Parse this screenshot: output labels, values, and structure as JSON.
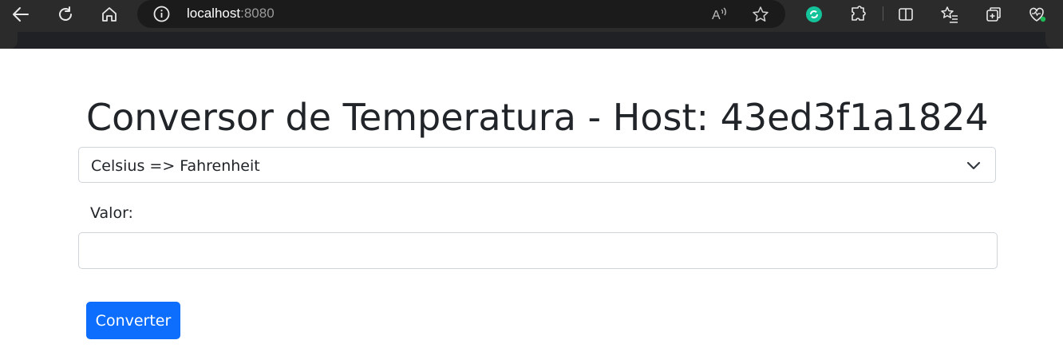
{
  "browser": {
    "url_host": "localhost",
    "url_port": ":8080",
    "icons": [
      "back-icon",
      "reload-icon",
      "home-icon",
      "site-info-icon",
      "read-aloud-icon",
      "favorite-star-icon",
      "extension-grammarly-icon",
      "extensions-puzzle-icon",
      "split-screen-icon",
      "favorites-list-icon",
      "collections-icon",
      "browser-essentials-icon"
    ],
    "read_aloud_glyph": "A",
    "accent_colors": {
      "chrome_bg": "#2b2b2b",
      "grammarly": "#15c39a",
      "status_dot": "#1db954"
    }
  },
  "page": {
    "title": "Conversor de Temperatura - Host: 43ed3f1a1824",
    "conversion_select": {
      "selected": "Celsius => Fahrenheit"
    },
    "value_label": "Valor:",
    "value_input": {
      "value": "",
      "placeholder": ""
    },
    "convert_button": "Converter",
    "primary_color": "#0d6efd"
  }
}
